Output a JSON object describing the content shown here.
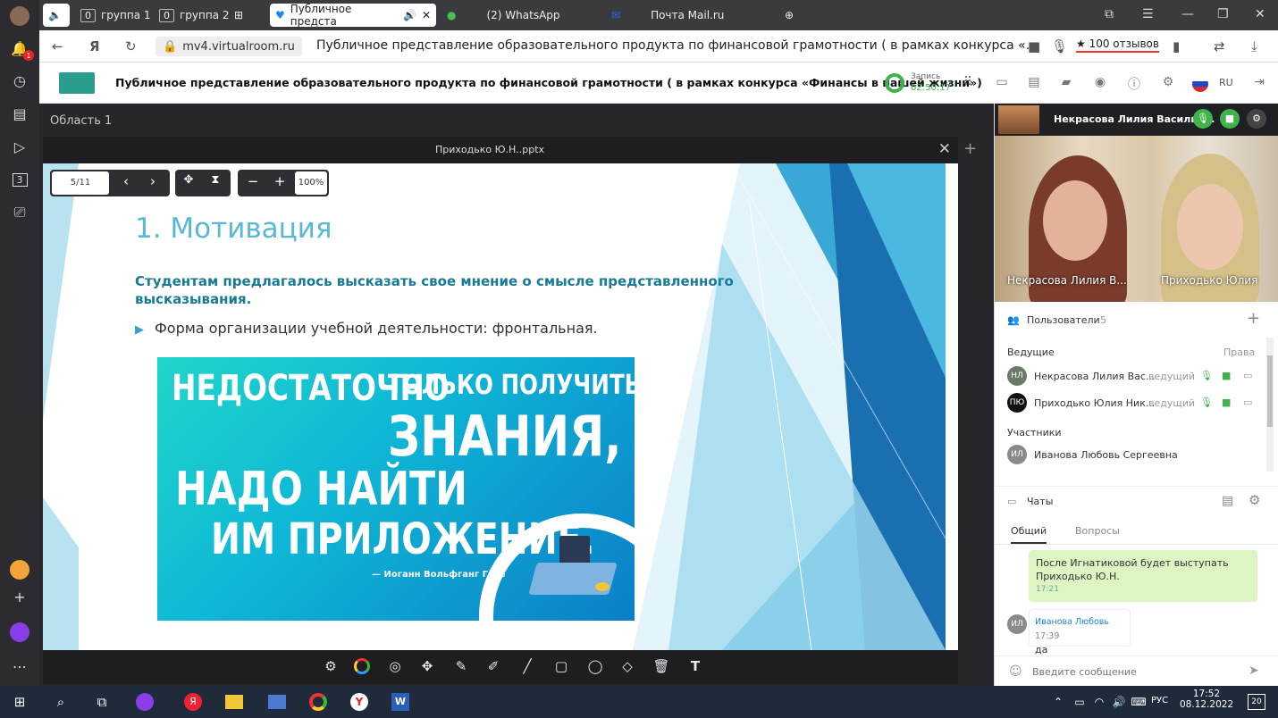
{
  "browser": {
    "tabs": [
      {
        "count": "0",
        "label": "группа 1"
      },
      {
        "count": "0",
        "label": "группа 2"
      },
      {
        "label": "Публичное предста"
      },
      {
        "label": "(2) WhatsApp"
      },
      {
        "label": "Почта Mail.ru"
      }
    ],
    "url": "mv4.virtualroom.ru",
    "page_title": "Публичное представление образовательного продукта по финансовой грамотности ( в рамках конкурса «...",
    "reviews": "★ 100 отзывов",
    "side_badge": "1",
    "side_counter": "3"
  },
  "app": {
    "event_title": "Публичное представление образовательного продукта по финансовой грамотности ( в рамках конкурса «Финансы в нашей жизни»)",
    "rec_label": "Запись",
    "rec_time": "02:50:17",
    "lang": "RU",
    "area_label": "Область 1",
    "doc_name": "Приходько Ю.Н..pptx"
  },
  "slide": {
    "page": "5/11",
    "zoom": "100%",
    "title": "1. Мотивация",
    "subtitle": "Студентам предлагалось высказать свое мнение о смысле представленного высказывания.",
    "bullet": "Форма организации учебной деятельности: фронтальная.",
    "quote_1": "НЕДОСТАТОЧНО",
    "quote_2": "ТОЛЬКО ПОЛУЧИТЬ",
    "quote_3": "ЗНАНИЯ,",
    "quote_4": "НАДО НАЙТИ",
    "quote_5": "ИМ ПРИЛОЖЕНИЕ.",
    "quote_author": "— Иоганн Вольфганг Гёте"
  },
  "panel": {
    "speaker_name": "Некрасова Лилия Василье...",
    "video_label_1": "Некрасова Лилия В...",
    "video_label_2": "Приходько Юлия",
    "users_label": "Пользователи",
    "users_count": "5",
    "hosts_label": "Ведущие",
    "rights_label": "Права",
    "participants_label": "Участники",
    "hosts": [
      {
        "initials": "НЛ",
        "name": "Некрасова Лилия Вас...",
        "role": "ведущий"
      },
      {
        "initials": "ПЮ",
        "name": "Приходько Юлия Ник...",
        "role": "ведущий"
      }
    ],
    "participants": [
      {
        "initials": "ИЛ",
        "name": "Иванова Любовь Сергеевна"
      }
    ],
    "chats_label": "Чаты",
    "tab_general": "Общий",
    "tab_questions": "Вопросы",
    "msg1_text": "После Игнатиковой будет выступать Приходько Ю.Н.",
    "msg1_time": "17:21",
    "msg2_initials": "ИЛ",
    "msg2_author": "Иванова Любовь",
    "msg2_time": "17:39",
    "msg2_text": "да",
    "input_placeholder": "Введите сообщение"
  },
  "taskbar": {
    "lang": "РУС",
    "time": "17:52",
    "date": "08.12.2022",
    "notifications": "20"
  },
  "colors": {
    "accent_green": "#41b34a",
    "slide_title": "#57b9d6",
    "slide_sub": "#1a7a95",
    "chat_bubble": "#dcf5c2"
  }
}
